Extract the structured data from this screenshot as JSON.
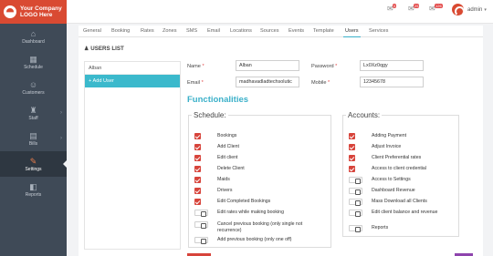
{
  "brand": {
    "logo_line1": "Your Company",
    "logo_line2": "LOGO Here"
  },
  "sidebar": {
    "items": [
      {
        "label": "Dashboard",
        "icon": "dashboard-icon",
        "glyph": "⌂",
        "arrow": false,
        "active": false
      },
      {
        "label": "Schedule",
        "icon": "calendar-icon",
        "glyph": "▦",
        "arrow": false,
        "active": false
      },
      {
        "label": "Customers",
        "icon": "customers-icon",
        "glyph": "☺",
        "arrow": false,
        "active": false
      },
      {
        "label": "Staff",
        "icon": "staff-icon",
        "glyph": "♜",
        "arrow": true,
        "active": false
      },
      {
        "label": "Bills",
        "icon": "bills-icon",
        "glyph": "▤",
        "arrow": true,
        "active": false
      },
      {
        "label": "Settings",
        "icon": "wrench-icon",
        "glyph": "✎",
        "arrow": false,
        "active": true
      },
      {
        "label": "Reports",
        "icon": "reports-icon",
        "glyph": "◧",
        "arrow": false,
        "active": false
      }
    ]
  },
  "topbar": {
    "notifications": [
      {
        "name": "notification-bell-1",
        "count": "0"
      },
      {
        "name": "notification-bell-2",
        "count": "25"
      },
      {
        "name": "notification-bell-3",
        "count": "126"
      }
    ],
    "user_label": "admin"
  },
  "tabs": [
    "General",
    "Booking",
    "Rates",
    "Zones",
    "SMS",
    "Email",
    "Locations",
    "Sources",
    "Events",
    "Template",
    "Users",
    "Services"
  ],
  "active_tab": "Users",
  "users_list": {
    "title": "USERS LIST",
    "users": [
      "Alban"
    ],
    "add_label": "+ Add User"
  },
  "form": {
    "name_label": "Name",
    "name_value": "Alban",
    "email_label": "Email",
    "email_value": "madhavadladtechsolutic",
    "password_label": "Password",
    "password_value": "Lx0Xz0qgy",
    "mobile_label": "Mobile",
    "mobile_value": "12345678",
    "required_mark": "*"
  },
  "functionalities": {
    "title": "Functionalities",
    "schedule": {
      "legend": "Schedule:",
      "items": [
        {
          "label": "Bookings",
          "checked": true
        },
        {
          "label": "Add Client",
          "checked": true
        },
        {
          "label": "Edit client",
          "checked": true
        },
        {
          "label": "Delete Client",
          "checked": true
        },
        {
          "label": "Maids",
          "checked": true
        },
        {
          "label": "Drivers",
          "checked": true
        },
        {
          "label": "Edit Completed Bookings",
          "checked": true
        },
        {
          "label": "Edit rates while making booking",
          "checked": false
        },
        {
          "label": "Cancel previous booking (only single not recurrence)",
          "checked": false
        },
        {
          "label": "Add previous booking (only one off)",
          "checked": false
        }
      ]
    },
    "accounts": {
      "legend": "Accounts:",
      "items": [
        {
          "label": "Adding Payment",
          "checked": true
        },
        {
          "label": "Adjust Invoice",
          "checked": true
        },
        {
          "label": "Client Preferential rates",
          "checked": true
        },
        {
          "label": "Access to client credential",
          "checked": true
        },
        {
          "label": "Access to Settings",
          "checked": false
        },
        {
          "label": "Dashboard Revenue",
          "checked": false
        },
        {
          "label": "Mass Download all Clients",
          "checked": false
        },
        {
          "label": "Edit client balance and revenue",
          "checked": false
        },
        {
          "label": "Reports",
          "checked": false
        }
      ]
    }
  },
  "colors": {
    "accent": "#3bb0c9",
    "brand": "#d94a32",
    "check_on": "#d7443b",
    "sidebar": "#3f4a57"
  }
}
